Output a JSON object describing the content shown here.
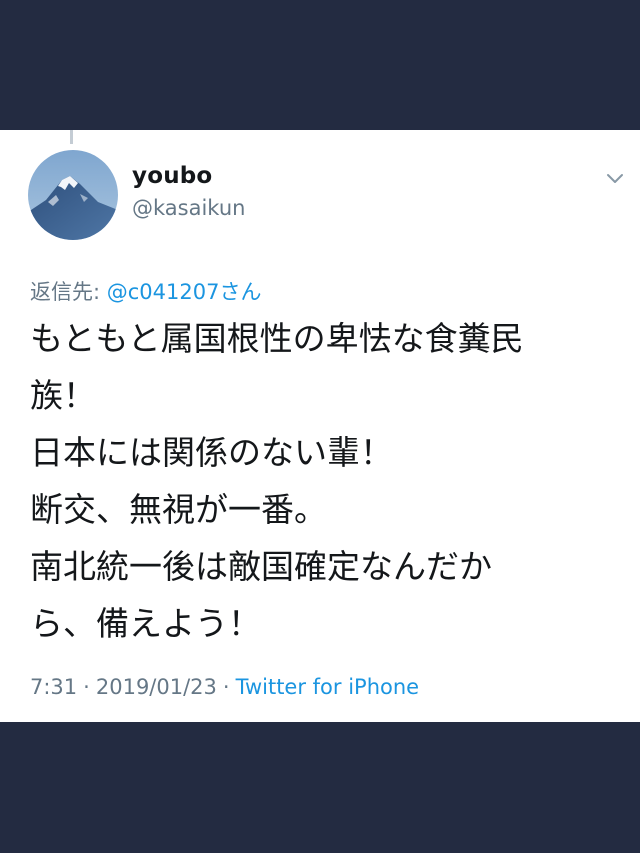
{
  "colors": {
    "background": "#232b41",
    "card": "#ffffff",
    "text_primary": "#14171a",
    "text_secondary": "#657786",
    "link": "#1b95e0"
  },
  "tweet": {
    "author": {
      "display_name": "youbo",
      "handle": "@kasaikun",
      "avatar_icon": "mountain-photo-avatar"
    },
    "reply_to": {
      "prefix": "返信先: ",
      "mention": "@c041207さん"
    },
    "text_lines": [
      "もともと属国根性の卑怯な食糞民",
      "族！",
      "日本には関係のない輩！",
      "断交、無視が一番。",
      "南北統一後は敵国確定なんだか",
      "ら、備えよう！"
    ],
    "meta": {
      "time": "7:31",
      "separator": "·",
      "date": "2019/01/23",
      "source": "Twitter for iPhone"
    },
    "menu_icon": "chevron-down-icon"
  }
}
